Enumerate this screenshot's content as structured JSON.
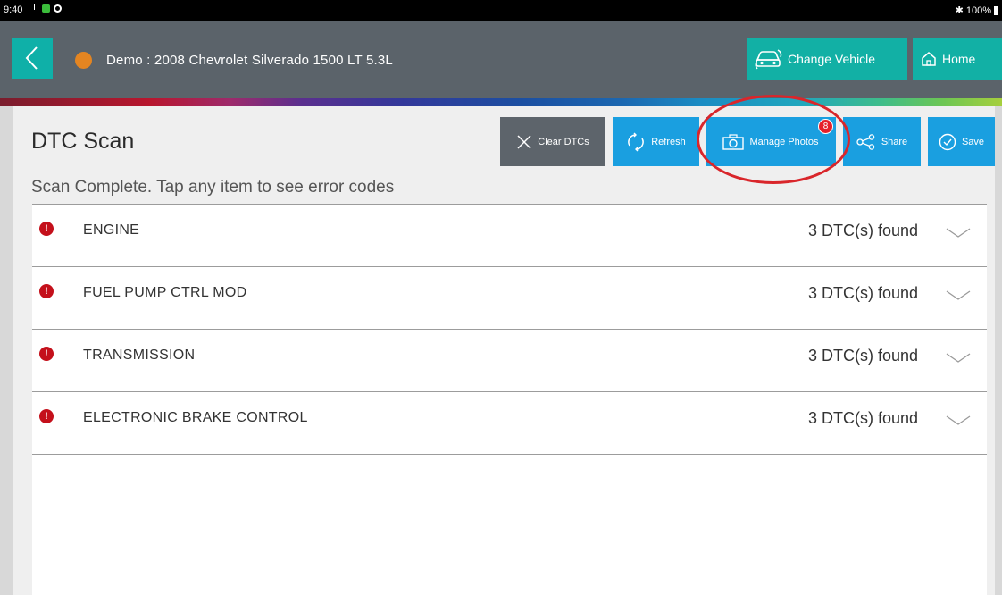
{
  "status_bar": {
    "time": "9:40",
    "battery": "100%"
  },
  "header": {
    "vehicle_title": "Demo : 2008 Chevrolet Silverado 1500 LT 5.3L",
    "change_vehicle_label": "Change Vehicle",
    "home_label": "Home"
  },
  "page": {
    "title": "DTC Scan",
    "subtitle": "Scan Complete. Tap any item to see error codes"
  },
  "toolbar": {
    "clear_dtcs_label": "Clear DTCs",
    "refresh_label": "Refresh",
    "manage_photos_label": "Manage Photos",
    "manage_photos_badge": "8",
    "share_label": "Share",
    "save_label": "Save"
  },
  "dtc_rows": [
    {
      "name": "ENGINE",
      "count": "3 DTC(s) found"
    },
    {
      "name": "FUEL PUMP CTRL MOD",
      "count": "3 DTC(s) found"
    },
    {
      "name": "TRANSMISSION",
      "count": "3 DTC(s) found"
    },
    {
      "name": "ELECTRONIC BRAKE CONTROL",
      "count": "3 DTC(s) found"
    }
  ],
  "colors": {
    "header_bg": "#5b636a",
    "accent_teal": "#12b0a5",
    "button_blue": "#1a9fe0",
    "error_red": "#c4101b",
    "vehicle_dot": "#e48521",
    "annotation_red": "#d9262b"
  },
  "icons": {
    "back": "chevron-left-icon",
    "change_vehicle": "car-swap-icon",
    "home": "home-icon",
    "clear": "close-icon",
    "refresh": "refresh-icon",
    "photos": "camera-icon",
    "share": "share-icon",
    "save": "check-circle-icon",
    "row_status": "error-icon",
    "row_expand": "chevron-down-icon"
  }
}
